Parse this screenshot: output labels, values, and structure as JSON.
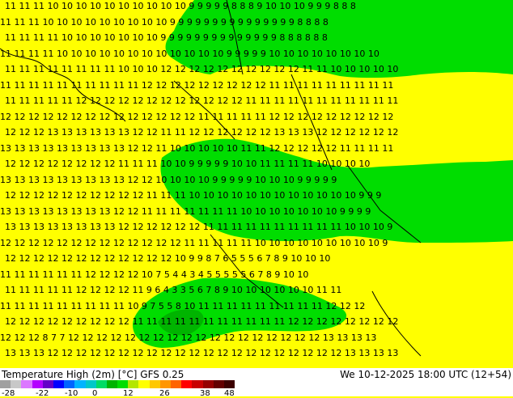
{
  "map": {
    "background_color": "#ffff00",
    "region_colors": {
      "cold": "#00dd00",
      "colder": "#00b400",
      "border": "#000000"
    },
    "grid_text_color": "#000000",
    "grid_numbers": [
      "11 11 11 10 10 10 10 10 10 10 10 10 10 9 9 9 9 9 8 8 8 9 10 10 10 9 9 9 8 8 8",
      "11 11 11 10 10 10 10 10 10 10 10 10 9 9 9 9 9 9 9 9 9 9 9 9 9 9 9 8 8 8 8",
      "11 11 11 11 10 10 10 10 10 10 10 9 9 9 9 9 9 9 9 9 9 9 9 9 9 8 8 8 8 8 8",
      "11 11 11 11 10 10 10 10 10 10 10 10 10 10 10 10 9 9 9 9 9 10 10 10 10 10 10 10 10",
      "11 11 11 11 11 11 11 11 10 10 10 12 12 12 12 12 12 12 12 12 12 11 11 10 10 10 10 10",
      "11 11 11 11 11 11 11 11 11 11 12 12 12 12 12 12 12 12 12 11 11 11 11 11 11 11 11 11",
      "11 11 11 11 11 12 12 12 12 12 12 12 12 12 12 12 12 11 11 11 11 11 11 11 11 11 11 11",
      "12 12 12 12 12 12 12 12 12 12 12 12 12 12 11 11 11 11 11 12 12 12 12 12 12 12 12 12",
      "12 12 12 13 13 13 13 13 13 12 12 11 11 12 12 12 12 12 12 13 13 13 12 12 12 12 12 12",
      "13 13 13 13 13 13 13 13 13 12 12 11 10 10 10 10 10 11 11 12 12 12 12 12 11 11 11 11",
      "12 12 12 12 12 12 12 12 11 11 11 10 10 9 9 9 9 9 10 10 11 11 11 11 10 10 10 10",
      "13 13 13 13 13 13 13 13 13 12 12 10 10 10 10 9 9 9 9 9 10 10 10 9 9 9 9 9",
      "12 12 12 12 12 12 12 12 12 12 11 11 11 10 10 10 10 10 10 10 10 10 10 10 10 9 9 9",
      "13 13 13 13 13 13 13 13 12 12 11 11 11 11 11 11 11 10 10 10 10 10 10 10 9 9 9 9",
      "13 13 13 13 13 13 13 13 12 12 12 12 12 12 11 11 11 11 11 11 11 11 11 11 10 10 10 9",
      "12 12 12 12 12 12 12 12 12 12 12 12 12 11 11 11 11 11 10 10 10 10 10 10 10 10 10 9",
      "12 12 12 12 12 12 12 12 12 12 12 12 10 9 9 8 7 6 5 5 5 6 7 8 9 10 10 10",
      "11 11 11 11 11 11 12 12 12 12 10 7 5 4 4 3 4 5 5 5 5 5 6 7 8 9 10 10",
      "11 11 11 11 11 12 12 12 12 11 9 6 4 3 3 5 6 7 8 9 10 10 10 10 10 10 11 11",
      "11 11 11 11 11 11 11 11 11 10 9 7 5 5 8 10 11 11 11 11 11 11 11 11 11 12 12 12",
      "12 12 12 12 12 12 12 12 12 11 11 11 11 11 11 11 11 11 11 11 12 12 12 12 12 12 12 12",
      "12 12 12 8 7 7 12 12 12 12 12 12 12 12 12 12 12 12 12 12 12 12 12 12 13 13 13 13",
      "13 13 13 12 12 12 12 12 12 12 12 12 12 12 12 12 12 12 12 12 12 12 12 12 13 13 13 13"
    ]
  },
  "footer": {
    "title": "Temperature High (2m) [°C] GFS 0.25",
    "valid_time": "We 10-12-2025 18:00 UTC (12+54)",
    "scale_ticks": [
      "-28",
      "-22",
      "-10",
      "0",
      "12",
      "26",
      "38",
      "48"
    ],
    "scale_colors": [
      "#a0a0a0",
      "#c8c8c8",
      "#dc78ff",
      "#b400ff",
      "#6400c8",
      "#0000ff",
      "#0064ff",
      "#00b4ff",
      "#00c8c8",
      "#00dc64",
      "#00b400",
      "#00dd00",
      "#b4e600",
      "#ffff00",
      "#ffc800",
      "#ff9600",
      "#ff6400",
      "#ff0000",
      "#c80000",
      "#960000",
      "#640000",
      "#3c0000"
    ]
  }
}
